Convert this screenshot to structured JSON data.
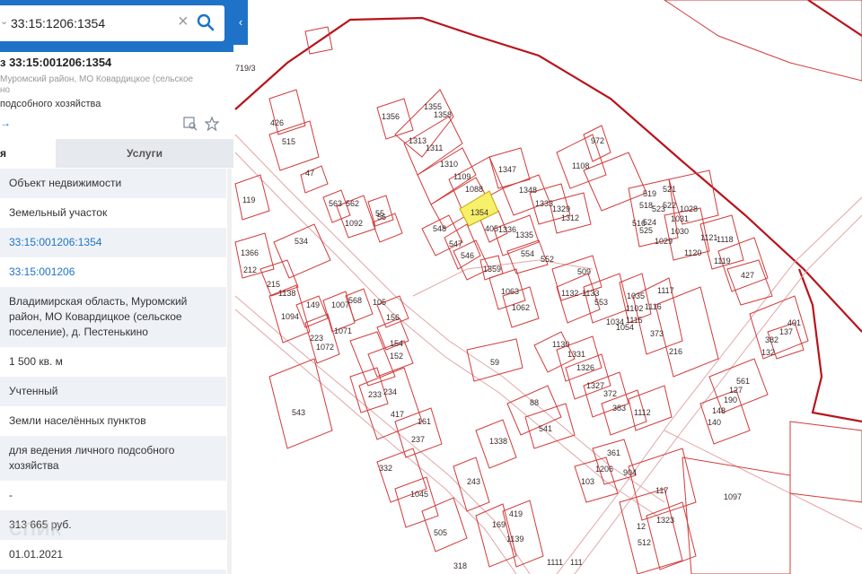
{
  "search": {
    "value": "33:15:1206:1354",
    "dropdown_icon": "chevron-down-icon"
  },
  "card": {
    "title": "з 33:15:001206:1354",
    "address_line1": "Муромский район, МО Ковардицкое (сельское",
    "address_line2": "но",
    "usage": "подсобного хозяйства",
    "share_label": "→"
  },
  "tabs": {
    "info": "я",
    "services": "Услуги"
  },
  "rows": [
    "Объект недвижимости",
    "Земельный участок",
    "33:15:001206:1354",
    "33:15:001206",
    "Владимирская область, Муромский район, МО Ковардицкое (сельское поселение), д. Пестенькино",
    "1 500 кв. м",
    "Учтенный",
    "Земли населённых пунктов",
    "для ведения личного подсобного хозяйства",
    "-",
    "313 665 руб.",
    "01.01.2021",
    "-"
  ],
  "watermark": "СПИК",
  "map": {
    "boundary_color": "#b8141c",
    "plot_color": "#d23a3a",
    "selected_color": "#f6f06a",
    "selected_plot": "1354",
    "labels": [
      "719/3",
      "1356",
      "1355",
      "1358",
      "1313",
      "1311",
      "1310",
      "1109",
      "1088",
      "1347",
      "1348",
      "1333",
      "1329",
      "1312",
      "1108",
      "972",
      "426",
      "515",
      "47",
      "563",
      "562",
      "1092",
      "55",
      "56",
      "548",
      "547",
      "546",
      "405",
      "1336",
      "1335",
      "554",
      "552",
      "1359",
      "1063",
      "1062",
      "509",
      "1132",
      "1133",
      "553",
      "1035",
      "1117",
      "1116",
      "1115",
      "1034",
      "373",
      "216",
      "1130",
      "1331",
      "1326",
      "1327",
      "372",
      "383",
      "1112",
      "59",
      "88",
      "541",
      "543",
      "417",
      "237",
      "161",
      "233",
      "234",
      "154",
      "152",
      "156",
      "105",
      "568",
      "1007",
      "1071",
      "1072",
      "223",
      "149",
      "1094",
      "1138",
      "215",
      "212",
      "534",
      "119",
      "1366",
      "1139",
      "169",
      "419",
      "505",
      "1045",
      "332",
      "243",
      "1338",
      "103",
      "904",
      "1206",
      "361",
      "117",
      "1097",
      "1323",
      "12",
      "512",
      "1111",
      "111",
      "318",
      "1028",
      "1031",
      "1030",
      "1029",
      "1120",
      "1121",
      "1118",
      "1119",
      "427",
      "521",
      "519",
      "518",
      "523",
      "522",
      "516",
      "524",
      "525",
      "401",
      "137",
      "382",
      "132",
      "561",
      "127",
      "190",
      "148",
      "140",
      "1102",
      "1054"
    ]
  }
}
